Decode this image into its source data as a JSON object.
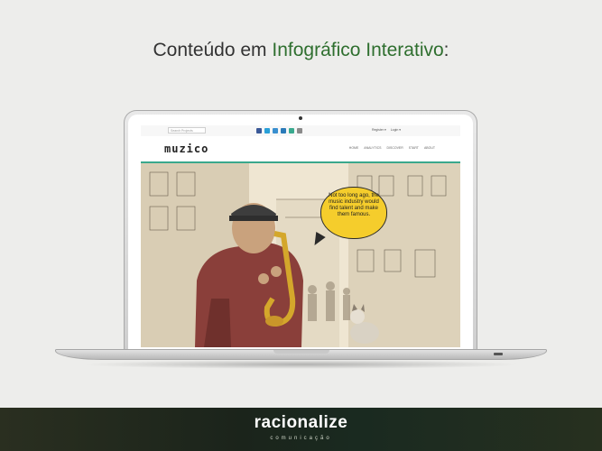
{
  "slide": {
    "title_prefix": "Conteúdo em ",
    "title_highlight": "Infográfico Interativo",
    "title_suffix": ":"
  },
  "site": {
    "search_placeholder": "Search Projects",
    "account": {
      "register": "Register ▾",
      "login": "Login ▾"
    },
    "social_icons": [
      {
        "name": "facebook-icon",
        "color": "#3b5998"
      },
      {
        "name": "twitter-icon",
        "color": "#2aa0d8"
      },
      {
        "name": "twitter-bird-icon",
        "color": "#3a8fcf"
      },
      {
        "name": "linkedin-icon",
        "color": "#2b7bb9"
      },
      {
        "name": "rss-icon",
        "color": "#3aaa8f"
      },
      {
        "name": "email-icon",
        "color": "#8a8a8a"
      }
    ],
    "logo": "muzico",
    "nav": [
      "HOME",
      "ANALYTICS",
      "DISCOVER",
      "START",
      "ABOUT"
    ],
    "hero_bubble": "Not too long ago, the music industry would find talent and make them famous.",
    "accent": "#3aa88c"
  },
  "footer": {
    "brand": "racionalize",
    "tagline": "comunicação",
    "bg": "#1e2a1c"
  }
}
